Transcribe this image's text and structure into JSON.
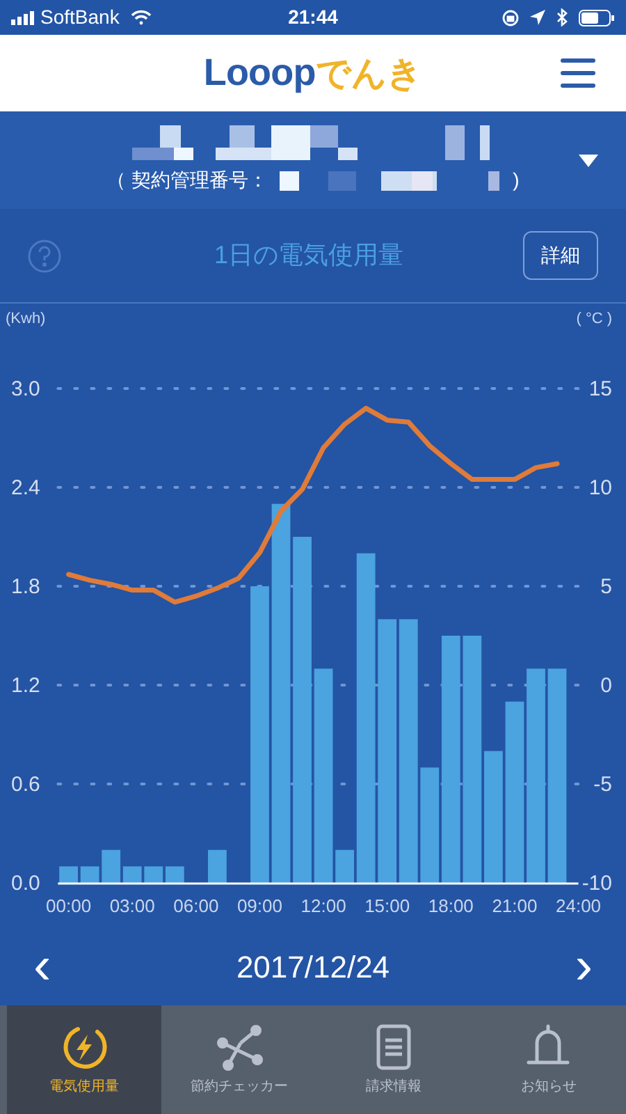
{
  "status_bar": {
    "carrier": "SoftBank",
    "time": "21:44"
  },
  "header": {
    "logo_main": "Looop",
    "logo_sub": "でんき"
  },
  "account": {
    "contract_label": "（ 契約管理番号：",
    "contract_close": ")"
  },
  "chart_panel": {
    "title": "1日の電気使用量",
    "detail_button": "詳細",
    "usage_chart": {
      "chart_data": {
        "type": "bar",
        "ylabel": "(Kwh)",
        "x": [
          0,
          1,
          2,
          3,
          4,
          5,
          6,
          7,
          8,
          9,
          10,
          11,
          12,
          13,
          14,
          15,
          16,
          17,
          18,
          19,
          20,
          21,
          22,
          23
        ],
        "series": [
          {
            "color": "#4ba3e0",
            "values": [
              0.1,
              0.1,
              0.2,
              0.1,
              0.1,
              0.1,
              0,
              0.2,
              0,
              1.8,
              2.3,
              2.1,
              1.3,
              0.2,
              2.0,
              1.6,
              1.6,
              0.7,
              1.5,
              1.5,
              0.8,
              1.1,
              1.3,
              1.3
            ]
          }
        ],
        "xlim": [
          -0.5,
          24
        ],
        "grid": true,
        "xticks": [
          {
            "value": 0,
            "label": "00:00"
          },
          {
            "value": 3,
            "label": "03:00"
          },
          {
            "value": 6,
            "label": "06:00"
          },
          {
            "value": 9,
            "label": "09:00"
          },
          {
            "value": 12,
            "label": "12:00"
          },
          {
            "value": 15,
            "label": "15:00"
          },
          {
            "value": 18,
            "label": "18:00"
          },
          {
            "value": 21,
            "label": "21:00"
          },
          {
            "value": 24,
            "label": "24:00"
          }
        ],
        "ylim": [
          0,
          3
        ],
        "yticks": [
          {
            "value": 0,
            "label": "0.0"
          },
          {
            "value": 0.6,
            "label": "0.6"
          },
          {
            "value": 1.2,
            "label": "1.2"
          },
          {
            "value": 1.8,
            "label": "1.8"
          },
          {
            "value": 2.4,
            "label": "2.4"
          },
          {
            "value": 3,
            "label": "3.0"
          }
        ]
      }
    },
    "temperature_chart": {
      "chart_data": {
        "type": "line",
        "ylabel": "( °C )",
        "series": [
          {
            "color": "#e07b39",
            "values": [
              5.6,
              5.3,
              5.1,
              4.8,
              4.8,
              4.2,
              4.5,
              4.9,
              5.4,
              6.7,
              8.8,
              9.9,
              12.0,
              13.2,
              14.0,
              13.4,
              13.3,
              12.1,
              11.2,
              10.4,
              10.4,
              10.4,
              11.0,
              11.2
            ]
          }
        ],
        "ylim": [
          -10,
          15
        ],
        "yticks": [
          {
            "value": -10,
            "label": "-10"
          },
          {
            "value": -5,
            "label": "-5"
          },
          {
            "value": 0,
            "label": "0"
          },
          {
            "value": 5,
            "label": "5"
          },
          {
            "value": 10,
            "label": "10"
          },
          {
            "value": 15,
            "label": "15"
          }
        ]
      }
    }
  },
  "date_nav": {
    "prev": "‹",
    "date": "2017/12/24",
    "next": "›"
  },
  "tabs": [
    {
      "kind": "power",
      "label": "電気使用量",
      "selected": true
    },
    {
      "kind": "graph",
      "label": "節約チェッカー",
      "selected": false
    },
    {
      "kind": "document",
      "label": "請求情報",
      "selected": false
    },
    {
      "kind": "bell",
      "label": "お知らせ",
      "selected": false
    }
  ]
}
